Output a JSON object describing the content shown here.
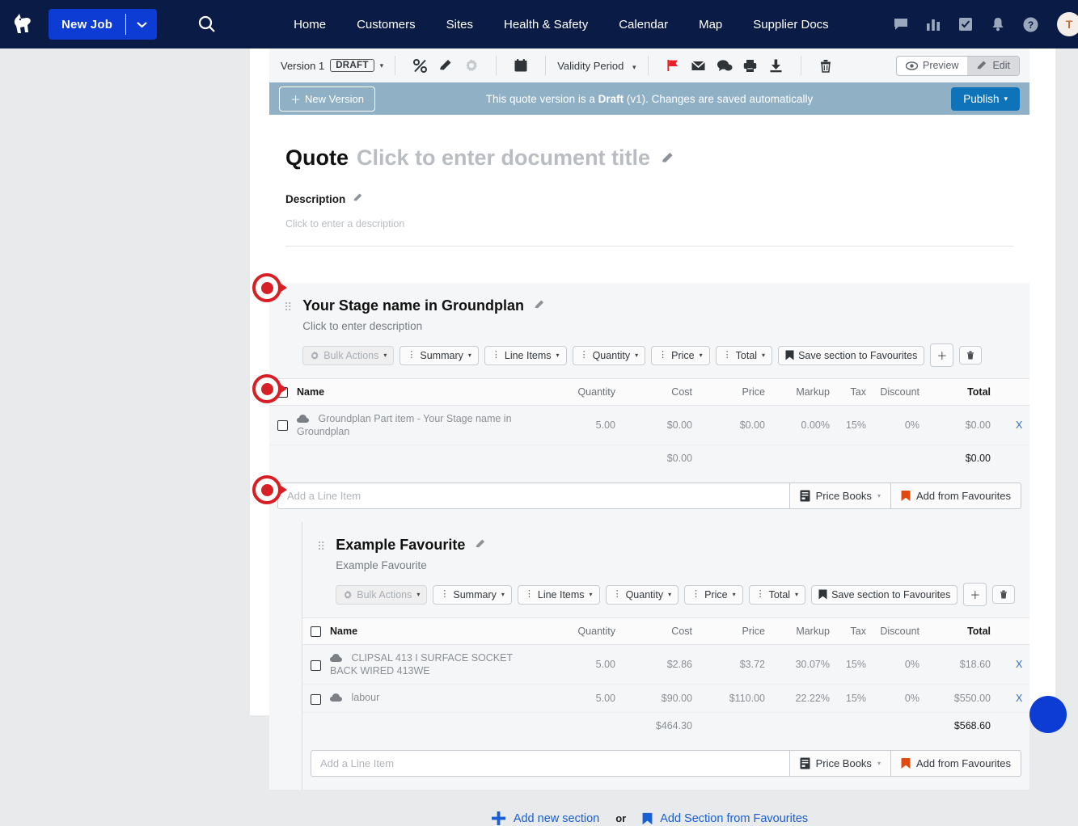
{
  "nav": {
    "logo_icon": "dog-logo-icon",
    "new_job_label": "New Job",
    "new_job_caret": "▾",
    "search_icon": "search-icon",
    "links": [
      {
        "label": "Home"
      },
      {
        "label": "Customers"
      },
      {
        "label": "Sites"
      },
      {
        "label": "Health & Safety"
      },
      {
        "label": "Calendar"
      },
      {
        "label": "Map"
      },
      {
        "label": "Supplier Docs"
      }
    ],
    "icons": [
      {
        "name": "chat-icon"
      },
      {
        "name": "reports-bar-chart-icon"
      },
      {
        "name": "tasks-checkbox-icon"
      },
      {
        "name": "notifications-bell-icon"
      },
      {
        "name": "help-question-icon"
      }
    ],
    "avatar_initial": "T"
  },
  "toolbar": {
    "version_label": "Version 1",
    "draft_badge": "DRAFT",
    "caret": "▾",
    "icons_group_1": [
      {
        "name": "percent-icon",
        "glyph": "%"
      },
      {
        "name": "edit-pencil-icon"
      },
      {
        "name": "settings-gear-icon"
      }
    ],
    "calendar_icon": "calendar-icon",
    "validity_period_label": "Validity Period",
    "icons_group_2": [
      {
        "name": "flag-icon"
      },
      {
        "name": "email-icon"
      },
      {
        "name": "comment-icon"
      },
      {
        "name": "print-icon"
      },
      {
        "name": "download-icon"
      }
    ],
    "delete_icon": "trash-icon",
    "preview_label": "Preview",
    "edit_label": "Edit"
  },
  "banner": {
    "new_version_label": "New Version",
    "new_version_plus": "＋",
    "message_prefix": "This quote version is a ",
    "message_bold": "Draft",
    "message_suffix": " (v1). Changes are saved automatically",
    "publish_label": "Publish",
    "publish_caret": "▾",
    "background_color": "#8fb0c5",
    "publish_color": "#0e73b9"
  },
  "document": {
    "title": "Quote",
    "title_placeholder": "Click to enter document title",
    "description_label": "Description",
    "description_placeholder": "Click to enter a description"
  },
  "section_toolbar_labels": {
    "bulk_actions": "Bulk Actions",
    "summary": "Summary",
    "line_items": "Line Items",
    "quantity": "Quantity",
    "price": "Price",
    "total": "Total",
    "save_to_favourites": "Save section to Favourites",
    "add_icon": "＋",
    "delete_icon": "trash-icon"
  },
  "table_headers": {
    "name": "Name",
    "quantity": "Quantity",
    "cost": "Cost",
    "price": "Price",
    "markup": "Markup",
    "tax": "Tax",
    "discount": "Discount",
    "total": "Total"
  },
  "add_line": {
    "placeholder": "Add a Line Item",
    "price_books_label": "Price Books",
    "price_books_caret": "▾",
    "add_from_favourites_label": "Add from Favourites"
  },
  "sections": [
    {
      "title": "Your Stage name in Groundplan",
      "description": "Click to enter description",
      "rows": [
        {
          "name": "Groundplan Part item - Your Stage name in Groundplan",
          "quantity": "5.00",
          "cost": "$0.00",
          "price": "$0.00",
          "markup": "0.00%",
          "tax": "15%",
          "discount": "0%",
          "total": "$0.00",
          "remove": "X"
        }
      ],
      "cost_subtotal": "$0.00",
      "total": "$0.00"
    },
    {
      "title": "Example Favourite",
      "description": "Example Favourite",
      "rows": [
        {
          "name": "CLIPSAL 413 I SURFACE SOCKET BACK WIRED 413WE",
          "quantity": "5.00",
          "cost": "$2.86",
          "price": "$3.72",
          "markup": "30.07%",
          "tax": "15%",
          "discount": "0%",
          "total": "$18.60",
          "remove": "X"
        },
        {
          "name": "labour",
          "quantity": "5.00",
          "cost": "$90.00",
          "price": "$110.00",
          "markup": "22.22%",
          "tax": "15%",
          "discount": "0%",
          "total": "$550.00",
          "remove": "X"
        }
      ],
      "cost_subtotal": "$464.30",
      "total": "$568.60"
    }
  ],
  "footer": {
    "add_new_section": "Add new section",
    "or": "or",
    "add_section_from_favourites": "Add Section from Favourites",
    "plus_icon": "plus-icon",
    "bookmark_icon": "bookmark-icon"
  },
  "annotations": [
    {
      "name": "annotation-marker-section-1"
    },
    {
      "name": "annotation-marker-line-item-1"
    },
    {
      "name": "annotation-marker-section-2"
    }
  ],
  "colors": {
    "nav_background": "#0a1c45",
    "primary_blue": "#0d3cd4",
    "link_blue": "#1860d3",
    "accent_red": "#d81f26",
    "favourite_orange": "#e2490f"
  }
}
